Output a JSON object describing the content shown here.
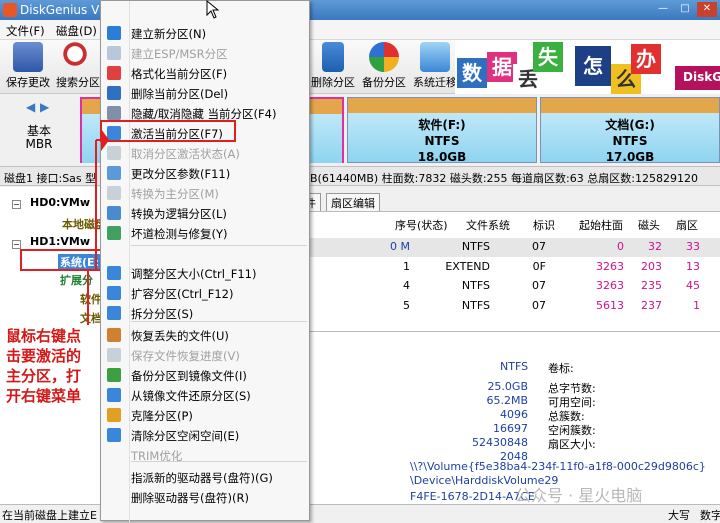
{
  "titlebar": {
    "title": "DiskGenius V5",
    "min": "—",
    "max": "□",
    "close": "✕"
  },
  "menubar": {
    "file": "文件(F)",
    "disk": "磁盘(D)"
  },
  "toolbar": {
    "save": "保存更改",
    "search": "搜索分区",
    "delete": "删除分区",
    "backup": "备份分区",
    "migrate": "系统迁移"
  },
  "banner": {
    "chars": [
      "数",
      "据",
      "丢",
      "失",
      "怎",
      "么",
      "办"
    ],
    "brand": "DiskGe"
  },
  "diskmap": {
    "nav_prev": "◀",
    "nav_next": "▶",
    "basic_line1": "基本",
    "basic_line2": "MBR",
    "partitions": [
      {
        "name": "软件(F:)",
        "fs": "NTFS",
        "size": "18.0GB"
      },
      {
        "name": "文档(G:)",
        "fs": "NTFS",
        "size": "17.0GB"
      }
    ]
  },
  "diskinfo": "磁盘1 接口:Sas  型",
  "diskinfo_right": "B(61440MB) 柱面数:7832 磁头数:255 每道扇区数:63 总扇区数:125829120",
  "tree": {
    "hd0": "HD0:VMw",
    "hd0_child": "本地磁盘",
    "hd1": "HD1:VMw",
    "sys": "系统(E:",
    "ext": "扩展分",
    "soft": "软件",
    "docs": "文档"
  },
  "tabs": {
    "file": "件",
    "sector": "扇区编辑"
  },
  "table": {
    "headers": [
      "序号(状态)",
      "文件系统",
      "标识",
      "起始柱面",
      "磁头",
      "扇区"
    ],
    "rows": [
      {
        "idx": "0 M",
        "fs": "NTFS",
        "id": "07",
        "cyl": "0",
        "head": "32",
        "sec": "33"
      },
      {
        "idx": "1",
        "fs": "EXTEND",
        "id": "0F",
        "cyl": "3263",
        "head": "203",
        "sec": "13"
      },
      {
        "idx": "4",
        "fs": "NTFS",
        "id": "07",
        "cyl": "3263",
        "head": "235",
        "sec": "45"
      },
      {
        "idx": "5",
        "fs": "NTFS",
        "id": "07",
        "cyl": "5613",
        "head": "237",
        "sec": "1"
      }
    ]
  },
  "details": {
    "fs_value": "NTFS",
    "fs_label": "卷标:",
    "values": [
      "25.0GB",
      "65.2MB",
      "4096",
      "16697",
      "52430848",
      "2048"
    ],
    "labels": [
      "总字节数:",
      "可用空间:",
      "总簇数:",
      "空闲簇数:",
      "扇区大小:"
    ],
    "guid_path": "\\\\?\\Volume{f5e38ba4-234f-11f0-a1f8-000c29d9806c}",
    "device_path": "\\Device\\HarddiskVolume29",
    "partial": "F4FE-1678-2D14-A7CE"
  },
  "status": {
    "left": "在当前磁盘上建立E",
    "right": "大写",
    "right2": "数字"
  },
  "context_menu": {
    "items": [
      {
        "label": "建立新分区(N)",
        "disabled": false,
        "color": "#2b7dd6"
      },
      {
        "label": "建立ESP/MSR分区",
        "disabled": true,
        "color": "#b8c8d8"
      },
      {
        "label": "格式化当前分区(F)",
        "disabled": false,
        "color": "#e04040"
      },
      {
        "label": "删除当前分区(Del)",
        "disabled": false,
        "color": "#3070c0"
      },
      {
        "label": "隐藏/取消隐藏 当前分区(F4)",
        "disabled": false,
        "color": "#8090a8"
      },
      {
        "label": "激活当前分区(F7)",
        "disabled": false,
        "color": "#3a86d8"
      },
      {
        "label": "取消分区激活状态(A)",
        "disabled": true,
        "color": "#c8d0d8"
      },
      {
        "label": "更改分区参数(F11)",
        "disabled": false,
        "color": "#5a9ad8"
      },
      {
        "label": "转换为主分区(M)",
        "disabled": true,
        "color": "#c8d0d8"
      },
      {
        "label": "转换为逻辑分区(L)",
        "disabled": false,
        "color": "#4a8ad0"
      },
      {
        "label": "坏道检测与修复(Y)",
        "disabled": false,
        "color": "#40a060"
      },
      {
        "label": "调整分区大小(Ctrl_F11)",
        "disabled": false,
        "color": "#3a86d8"
      },
      {
        "label": "扩容分区(Ctrl_F12)",
        "disabled": false,
        "color": "#3a86d8"
      },
      {
        "label": "拆分分区(S)",
        "disabled": false,
        "color": "#3a86d8"
      },
      {
        "label": "恢复丢失的文件(U)",
        "disabled": false,
        "color": "#d08030"
      },
      {
        "label": "保存文件恢复进度(V)",
        "disabled": true,
        "color": "#c8d0d8"
      },
      {
        "label": "备份分区到镜像文件(I)",
        "disabled": false,
        "color": "#3aa040"
      },
      {
        "label": "从镜像文件还原分区(S)",
        "disabled": false,
        "color": "#3a86d8"
      },
      {
        "label": "克隆分区(P)",
        "disabled": false,
        "color": "#e0a020"
      },
      {
        "label": "清除分区空闲空间(E)",
        "disabled": false,
        "color": "#3a86d8"
      },
      {
        "label": "TRIM优化",
        "disabled": true,
        "color": "#f7f7f7"
      },
      {
        "label": "指派新的驱动器号(盘符)(G)",
        "disabled": false,
        "color": "#f7f7f7"
      },
      {
        "label": "删除驱动器号(盘符)(R)",
        "disabled": false,
        "color": "#f7f7f7"
      }
    ]
  },
  "annotation": {
    "lines": [
      "鼠标右键点",
      "击要激活的",
      "主分区，打",
      "开右键菜单"
    ]
  },
  "watermark": "公众号 · 星火电脑",
  "colors": {
    "title": "#3a78c0",
    "highlight": "#e02020",
    "partition_bar": "#e3a64a",
    "partition_body": "#8fd4f0",
    "cyl_value": "#d01090",
    "head_value": "#d01090"
  }
}
